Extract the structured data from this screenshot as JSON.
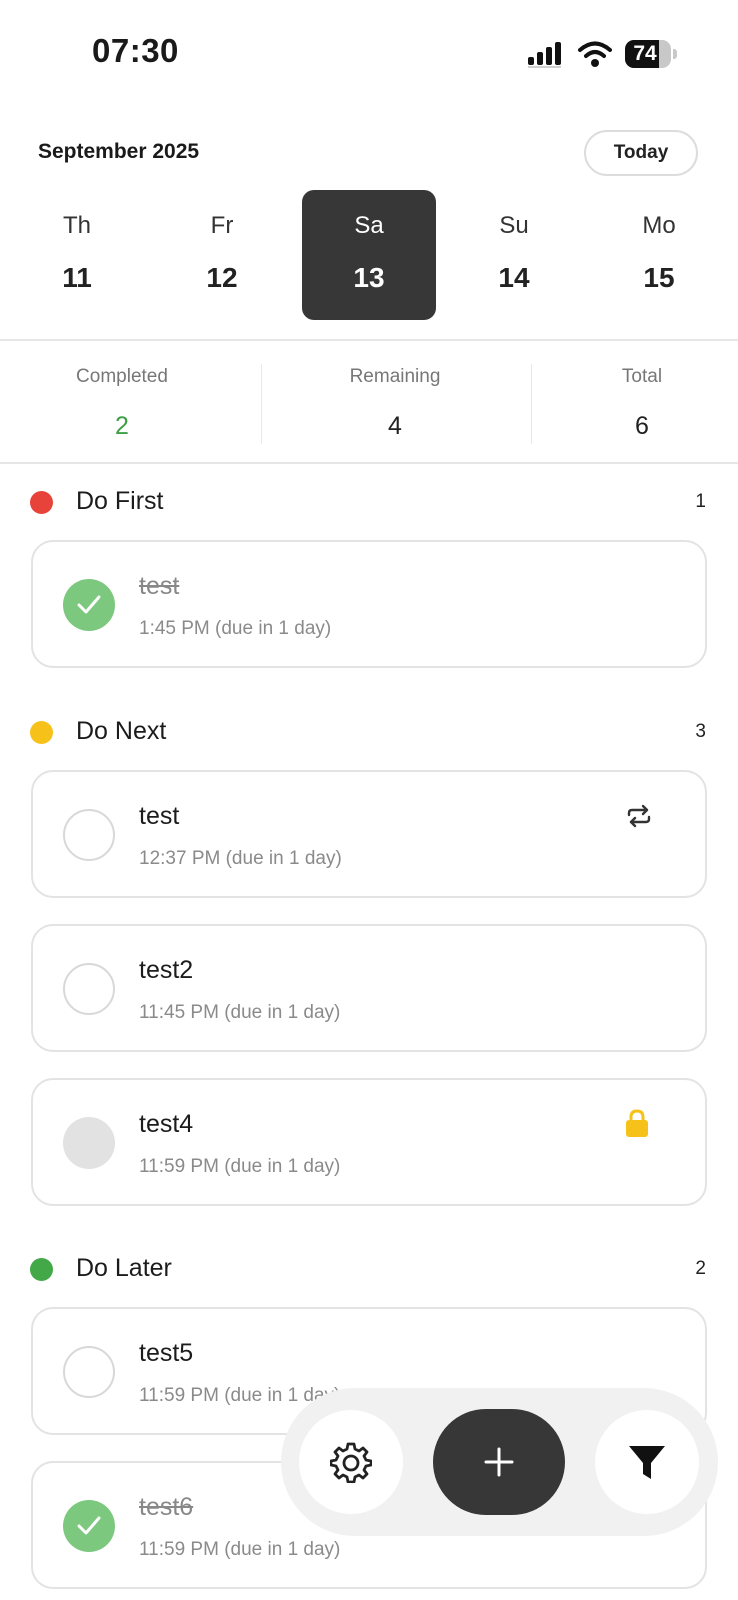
{
  "status_bar": {
    "time": "07:30",
    "battery_level": "74",
    "battery_fraction": 0.74
  },
  "header": {
    "month": "September 2025",
    "today_button": "Today"
  },
  "week": [
    {
      "name": "Th",
      "date": "11",
      "selected": false
    },
    {
      "name": "Fr",
      "date": "12",
      "selected": false
    },
    {
      "name": "Sa",
      "date": "13",
      "selected": true
    },
    {
      "name": "Su",
      "date": "14",
      "selected": false
    },
    {
      "name": "Mo",
      "date": "15",
      "selected": false
    }
  ],
  "stats": {
    "completed": {
      "label": "Completed",
      "value": "2"
    },
    "remaining": {
      "label": "Remaining",
      "value": "4"
    },
    "total": {
      "label": "Total",
      "value": "6"
    }
  },
  "sections": [
    {
      "title": "Do First",
      "count": "1",
      "color": "#e8433a",
      "tasks": [
        {
          "title": "test",
          "subtitle": "1:45 PM (due in 1 day)",
          "state": "done",
          "icon": ""
        }
      ]
    },
    {
      "title": "Do Next",
      "count": "3",
      "color": "#f6c21a",
      "tasks": [
        {
          "title": "test",
          "subtitle": "12:37 PM (due in 1 day)",
          "state": "open",
          "icon": "repeat-icon"
        },
        {
          "title": "test2",
          "subtitle": "11:45 PM (due in 1 day)",
          "state": "open",
          "icon": ""
        },
        {
          "title": "test4",
          "subtitle": "11:59 PM (due in 1 day)",
          "state": "locked",
          "icon": "lock-icon"
        }
      ]
    },
    {
      "title": "Do Later",
      "count": "2",
      "color": "#43a847",
      "tasks": [
        {
          "title": "test5",
          "subtitle": "11:59 PM (due in 1 day)",
          "state": "open",
          "icon": ""
        },
        {
          "title": "test6",
          "subtitle": "11:59 PM (due in 1 day)",
          "state": "done",
          "icon": ""
        }
      ]
    }
  ],
  "colors": {
    "completed_value": "#3e9e44",
    "selected_day_bg": "#373737",
    "done_check": "#7cc87e",
    "lock": "#f6c21a"
  },
  "toolbar": {
    "settings_icon": "gear-icon",
    "add_icon": "plus-icon",
    "filter_icon": "filter-icon"
  }
}
